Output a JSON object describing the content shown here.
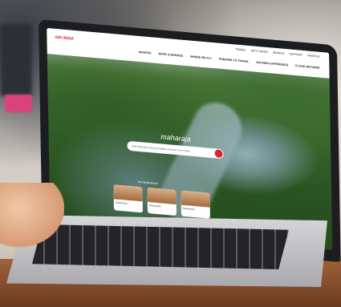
{
  "site": {
    "logo": "AIR INDIA",
    "brand_mark": "maharaja",
    "top_links": [
      "TRAVEL",
      "GIFT CARDS",
      "SEARCH",
      "SUPPORT",
      "PROFILE"
    ],
    "main_nav": [
      "MANAGE",
      "BOOK & MANAGE",
      "WHERE WE FLY",
      "PREPARE TO TRAVEL",
      "AIR INDIA EXPERIENCE",
      "FLYING RETURNS"
    ],
    "search_placeholder": "Ask Maharaja to find your flights and book on Air India",
    "cards_title": "Top destinations",
    "cards": [
      {
        "label": "Destination"
      },
      {
        "label": "Destination"
      },
      {
        "label": "Destination"
      }
    ]
  }
}
